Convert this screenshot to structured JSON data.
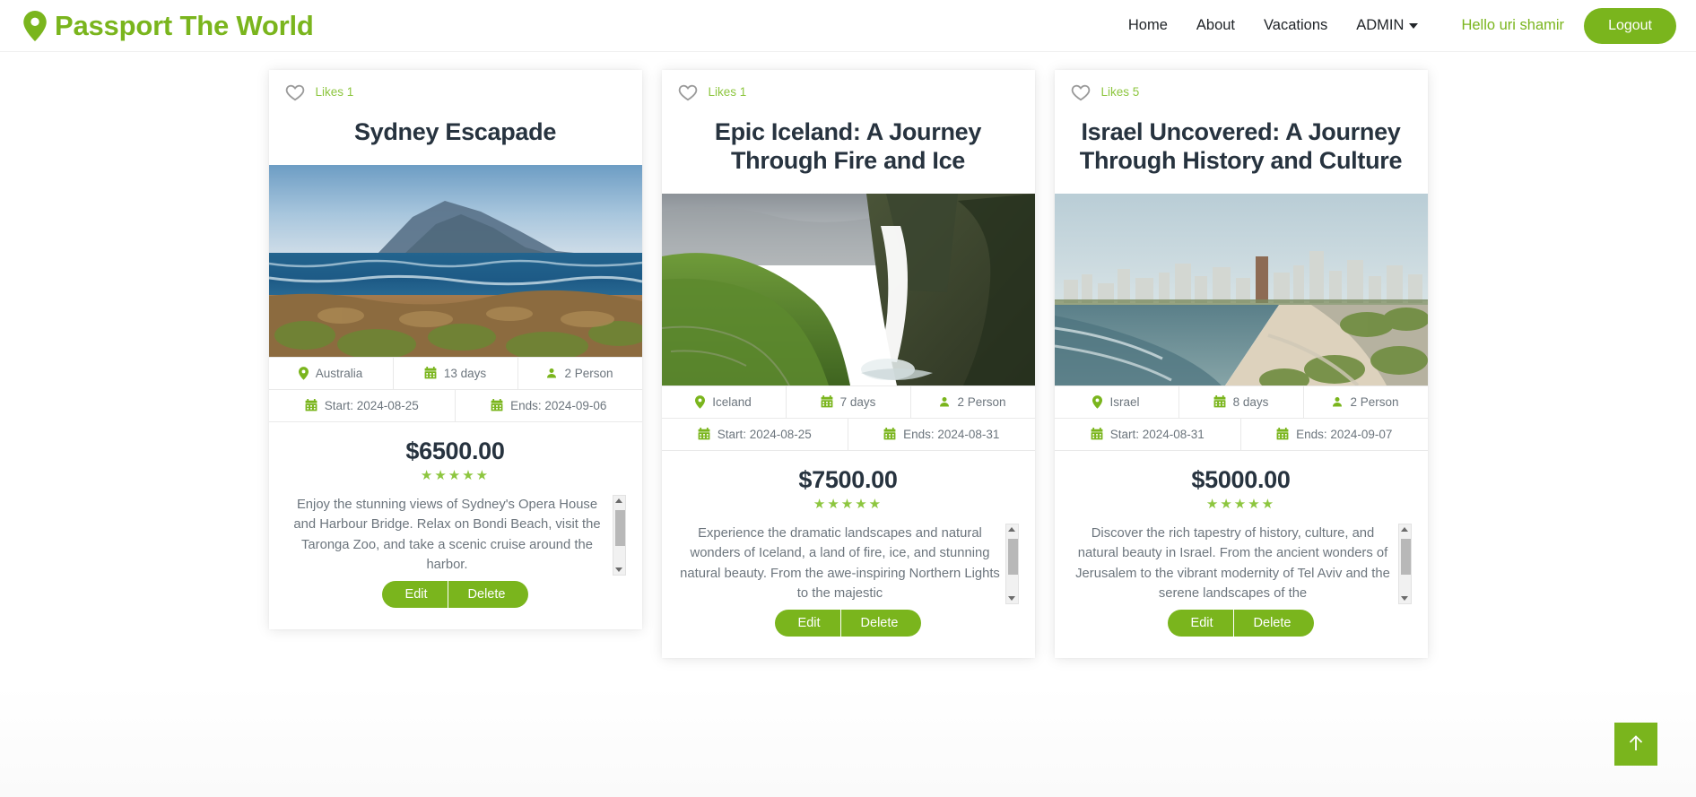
{
  "navbar": {
    "brand": "Passport The World",
    "brand_icon": "map-pin-icon",
    "brand_color": "#7ab51d",
    "links": [
      {
        "label": "Home"
      },
      {
        "label": "About"
      },
      {
        "label": "Vacations"
      }
    ],
    "dropdown": {
      "label": "ADMIN",
      "icon": "chevron-down-icon"
    },
    "greeting": "Hello uri shamir",
    "logout_label": "Logout"
  },
  "cards": [
    {
      "likes_label": "Likes 1",
      "title": "Sydney Escapade",
      "image_alt": "Australian coastline with rocky shore and mountain",
      "destination": "Australia",
      "duration": "13 days",
      "persons": "2 Person",
      "start": "Start: 2024-08-25",
      "ends": "Ends: 2024-09-06",
      "price": "$6500.00",
      "stars": "★★★★★",
      "description": "Enjoy the stunning views of Sydney's Opera House and Harbour Bridge. Relax on Bondi Beach, visit the Taronga Zoo, and take a scenic cruise around the harbor.",
      "edit_label": "Edit",
      "delete_label": "Delete"
    },
    {
      "likes_label": "Likes 1",
      "title": "Epic Iceland: A Journey Through Fire and Ice",
      "image_alt": "Iceland waterfall cascading over green mossy cliff",
      "destination": "Iceland",
      "duration": "7 days",
      "persons": "2 Person",
      "start": "Start: 2024-08-25",
      "ends": "Ends: 2024-08-31",
      "price": "$7500.00",
      "stars": "★★★★★",
      "description": "Experience the dramatic landscapes and natural wonders of Iceland, a land of fire, ice, and stunning natural beauty. From the awe-inspiring Northern Lights to the majestic",
      "edit_label": "Edit",
      "delete_label": "Delete"
    },
    {
      "likes_label": "Likes 5",
      "title": "Israel Uncovered: A Journey Through History and Culture",
      "image_alt": "Tel Aviv coastline skyline with beach",
      "destination": "Israel",
      "duration": "8 days",
      "persons": "2 Person",
      "start": "Start: 2024-08-31",
      "ends": "Ends: 2024-09-07",
      "price": "$5000.00",
      "stars": "★★★★★",
      "description": "Discover the rich tapestry of history, culture, and natural beauty in Israel. From the ancient wonders of Jerusalem to the vibrant modernity of Tel Aviv and the serene landscapes of the",
      "edit_label": "Edit",
      "delete_label": "Delete"
    }
  ],
  "scroll_top": {
    "icon": "arrow-up-icon",
    "color": "#7ab51d"
  }
}
